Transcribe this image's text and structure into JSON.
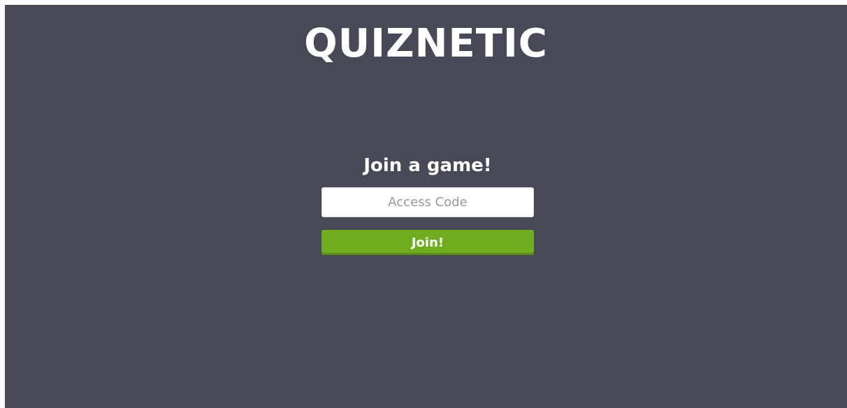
{
  "brand": {
    "title": "QUIZNETIC"
  },
  "join": {
    "heading": "Join a game!",
    "access_code": {
      "placeholder": "Access Code",
      "value": ""
    },
    "button_label": "Join!"
  },
  "colors": {
    "background": "#474a56",
    "button": "#6fad1f",
    "text": "#ffffff"
  }
}
